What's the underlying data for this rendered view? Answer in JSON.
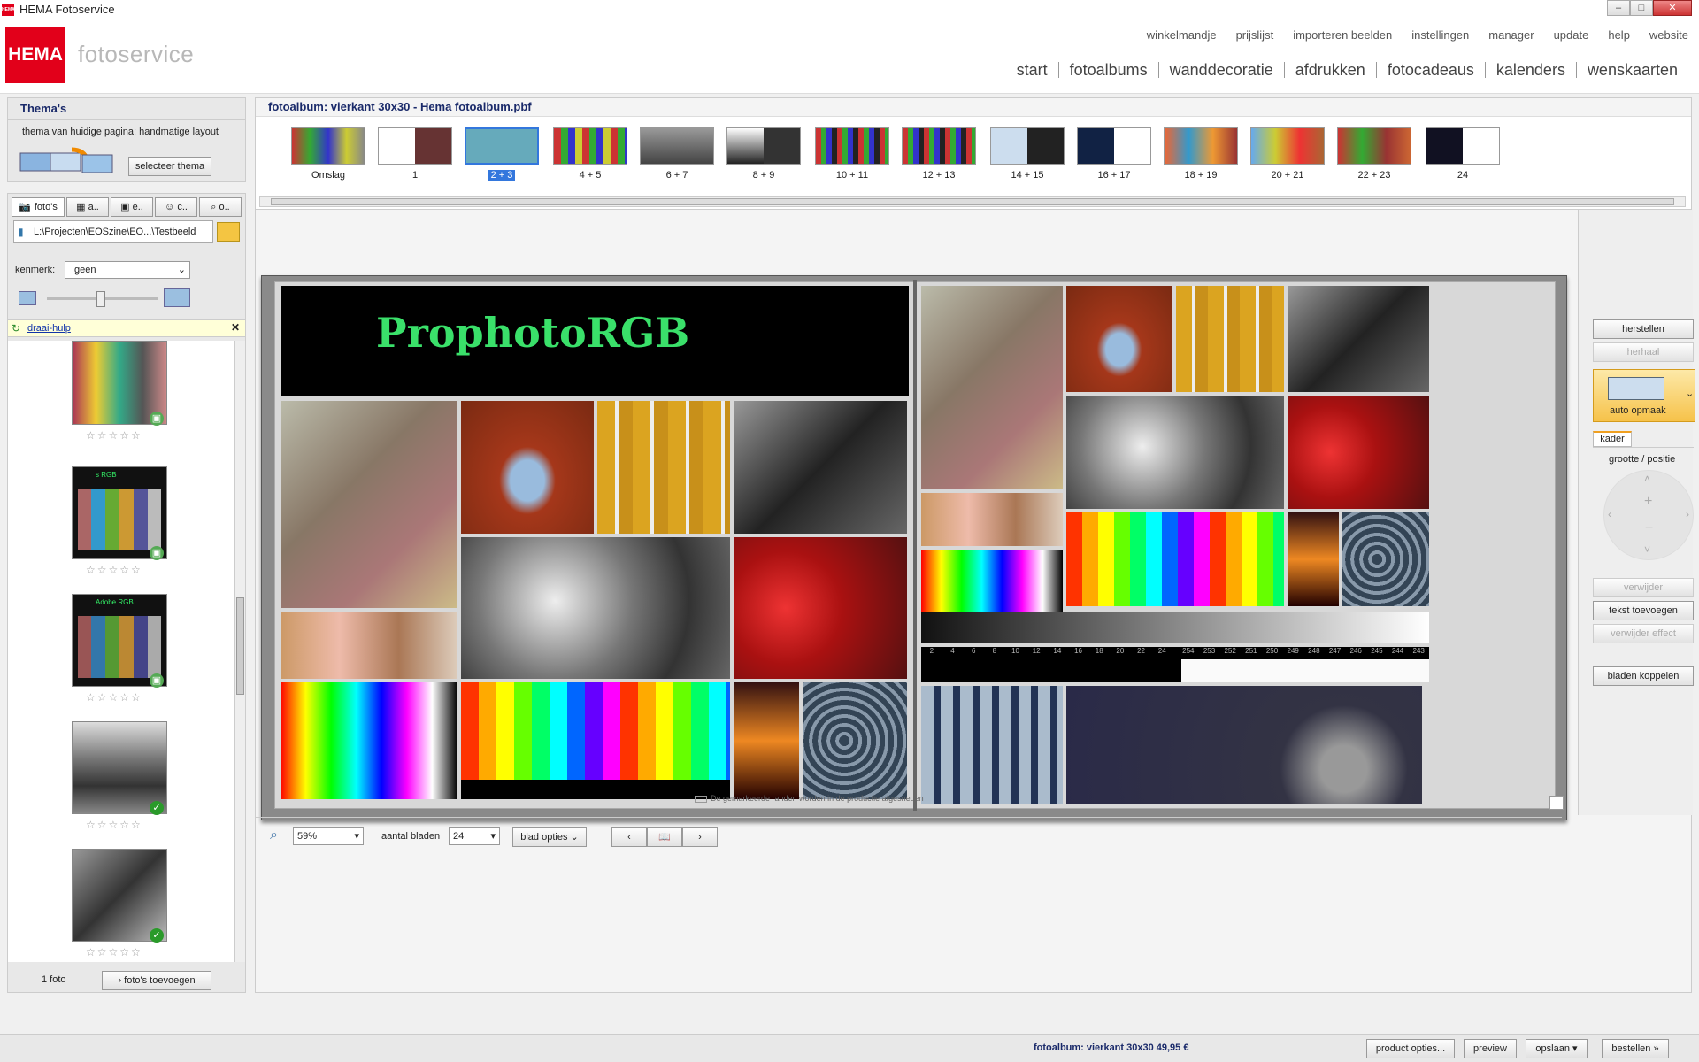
{
  "window": {
    "title": "HEMA Fotoservice",
    "logo_text": "HEMA",
    "minimize": "–",
    "maximize": "□",
    "close": "✕"
  },
  "header": {
    "logo": "HEMA",
    "subtitle": "fotoservice",
    "top_links": [
      "winkelmandje",
      "prijslijst",
      "importeren beelden",
      "instellingen",
      "manager",
      "update",
      "help",
      "website"
    ],
    "main_nav": [
      "start",
      "fotoalbums",
      "wanddecoratie",
      "afdrukken",
      "fotocadeaus",
      "kalenders",
      "wenskaarten"
    ]
  },
  "themes": {
    "title": "Thema's",
    "current": "thema van huidige pagina: handmatige layout",
    "select_button": "selecteer thema"
  },
  "tabs": [
    "foto's",
    "a..",
    "e..",
    "c..",
    "o.."
  ],
  "path": "L:\\Projecten\\EOSzine\\EO...\\Testbeeld",
  "filter": {
    "label": "kenmerk:",
    "value": "geen"
  },
  "rotate_help": "draai-hulp",
  "photo_labels": [
    "s RGB",
    "Adobe RGB"
  ],
  "photo_count": "1 foto",
  "add_photos": "foto's toevoegen",
  "album": {
    "title": "fotoalbum: vierkant 30x30 - Hema fotoalbum.pbf",
    "pages": [
      "Omslag",
      "1",
      "2 + 3",
      "4 + 5",
      "6 + 7",
      "8 + 9",
      "10 + 11",
      "12 + 13",
      "14 + 15",
      "16 + 17",
      "18 + 19",
      "20 + 21",
      "22 + 23",
      "24"
    ],
    "selected_page": "2 + 3"
  },
  "spread": {
    "title": "ProphotoRGB",
    "gray_labels": [
      "2",
      "4",
      "6",
      "8",
      "10",
      "12",
      "14",
      "16",
      "18",
      "20",
      "22",
      "24"
    ],
    "white_labels": [
      "254",
      "253",
      "252",
      "251",
      "250",
      "249",
      "248",
      "247",
      "246",
      "245",
      "244",
      "243"
    ]
  },
  "crop_note": "De gemarkeerde randen worden in de productie afgesneden",
  "bottom": {
    "zoom": "59%",
    "sheets_label": "aantal bladen",
    "sheets_value": "24",
    "sheet_options": "blad opties",
    "prev": "‹",
    "next": "›"
  },
  "right": {
    "restore": "herstellen",
    "redo": "herhaal",
    "auto_layout": "auto opmaak",
    "frame_tab": "kader",
    "size_position": "grootte / positie",
    "plus": "+",
    "minus": "−",
    "delete": "verwijder",
    "add_text": "tekst toevoegen",
    "remove_effect": "verwijder effect",
    "link_sheets": "bladen koppelen"
  },
  "status": {
    "product": "fotoalbum: vierkant 30x30 49,95 €",
    "product_options": "product opties...",
    "preview": "preview",
    "save": "opslaan",
    "order": "bestellen"
  }
}
